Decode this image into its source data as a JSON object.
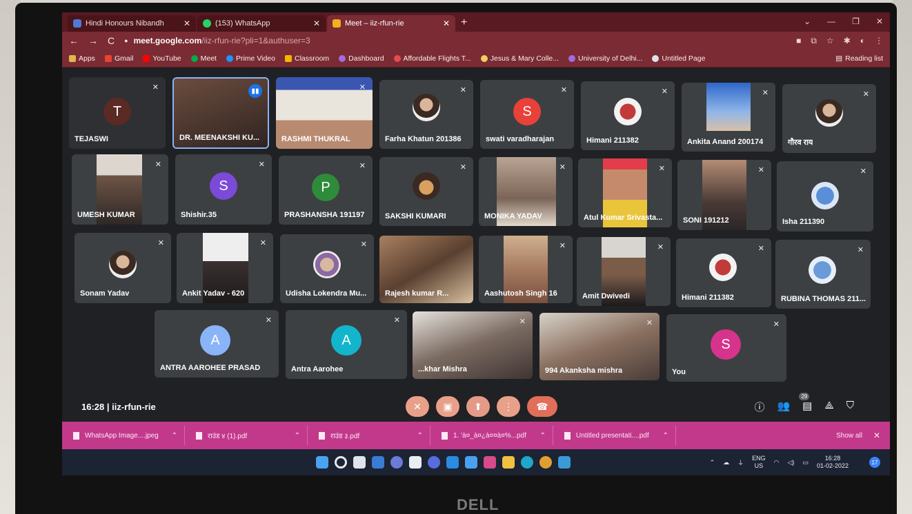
{
  "tabs": [
    {
      "label": "Hindi Honours Nibandh",
      "icon_color": "#4f7ad8"
    },
    {
      "label": "(153) WhatsApp",
      "icon_color": "#25d366"
    },
    {
      "label": "Meet – iiz-rfun-rie",
      "icon_color": "#f2b01e"
    }
  ],
  "address": {
    "host": "meet.google.com",
    "path": "/iiz-rfun-rie?pli=1&authuser=3"
  },
  "bookmarks": [
    "Apps",
    "Gmail",
    "YouTube",
    "Meet",
    "Prime Video",
    "Classroom",
    "Dashboard",
    "Affordable Flights T...",
    "Jesus & Mary Colle...",
    "University of Delhi...",
    "Untitled Page"
  ],
  "reading_list": "Reading list",
  "participants": [
    {
      "name": "TEJASWI",
      "letter": "T"
    },
    {
      "name": "DR. MEENAKSHI KU..."
    },
    {
      "name": "RASHMI THUKRAL"
    },
    {
      "name": "Farha Khatun 201386"
    },
    {
      "name": "swati varadharajan",
      "letter": "S"
    },
    {
      "name": "Himani 211382"
    },
    {
      "name": "Ankita Anand 200174"
    },
    {
      "name": "गौरव राय"
    },
    {
      "name": "UMESH KUMAR"
    },
    {
      "name": "Shishir.35",
      "letter": "S"
    },
    {
      "name": "PRASHANSHA 191197",
      "letter": "P"
    },
    {
      "name": "SAKSHI KUMARI"
    },
    {
      "name": "MONIKA YADAV"
    },
    {
      "name": "Atul Kumar Srivasta..."
    },
    {
      "name": "SONI 191212"
    },
    {
      "name": "Isha 211390"
    },
    {
      "name": "Sonam Yadav"
    },
    {
      "name": "Ankit Yadav - 620"
    },
    {
      "name": "Udisha Lokendra Mu..."
    },
    {
      "name": "Rajesh kumar R..."
    },
    {
      "name": "Aashutosh Singh 16"
    },
    {
      "name": "Amit Dwivedi"
    },
    {
      "name": "Himani 211382"
    },
    {
      "name": "RUBINA THOMAS 211..."
    },
    {
      "name": "ANTRA AAROHEE PRASAD",
      "letter": "A"
    },
    {
      "name": "Antra Aarohee",
      "letter": "A"
    },
    {
      "name": "...khar Mishra"
    },
    {
      "name": "994 Akanksha mishra"
    },
    {
      "name": "You",
      "letter": "S"
    }
  ],
  "meeting": {
    "time": "16:28",
    "code": "iiz-rfun-rie",
    "participant_count": "29"
  },
  "downloads": [
    "WhatsApp Image....jpeg",
    "राउंड ४ (1).pdf",
    "राउंड ३.pdf",
    "1. 'à¤_à¤¿à¤¤à¤%...pdf",
    "Untitled presentati....pdf"
  ],
  "show_all": "Show all",
  "taskbar": {
    "lang": "ENG",
    "region": "US",
    "time": "16:28",
    "date": "01-02-2022",
    "notifications": "17"
  },
  "monitor_brand": "DELL"
}
